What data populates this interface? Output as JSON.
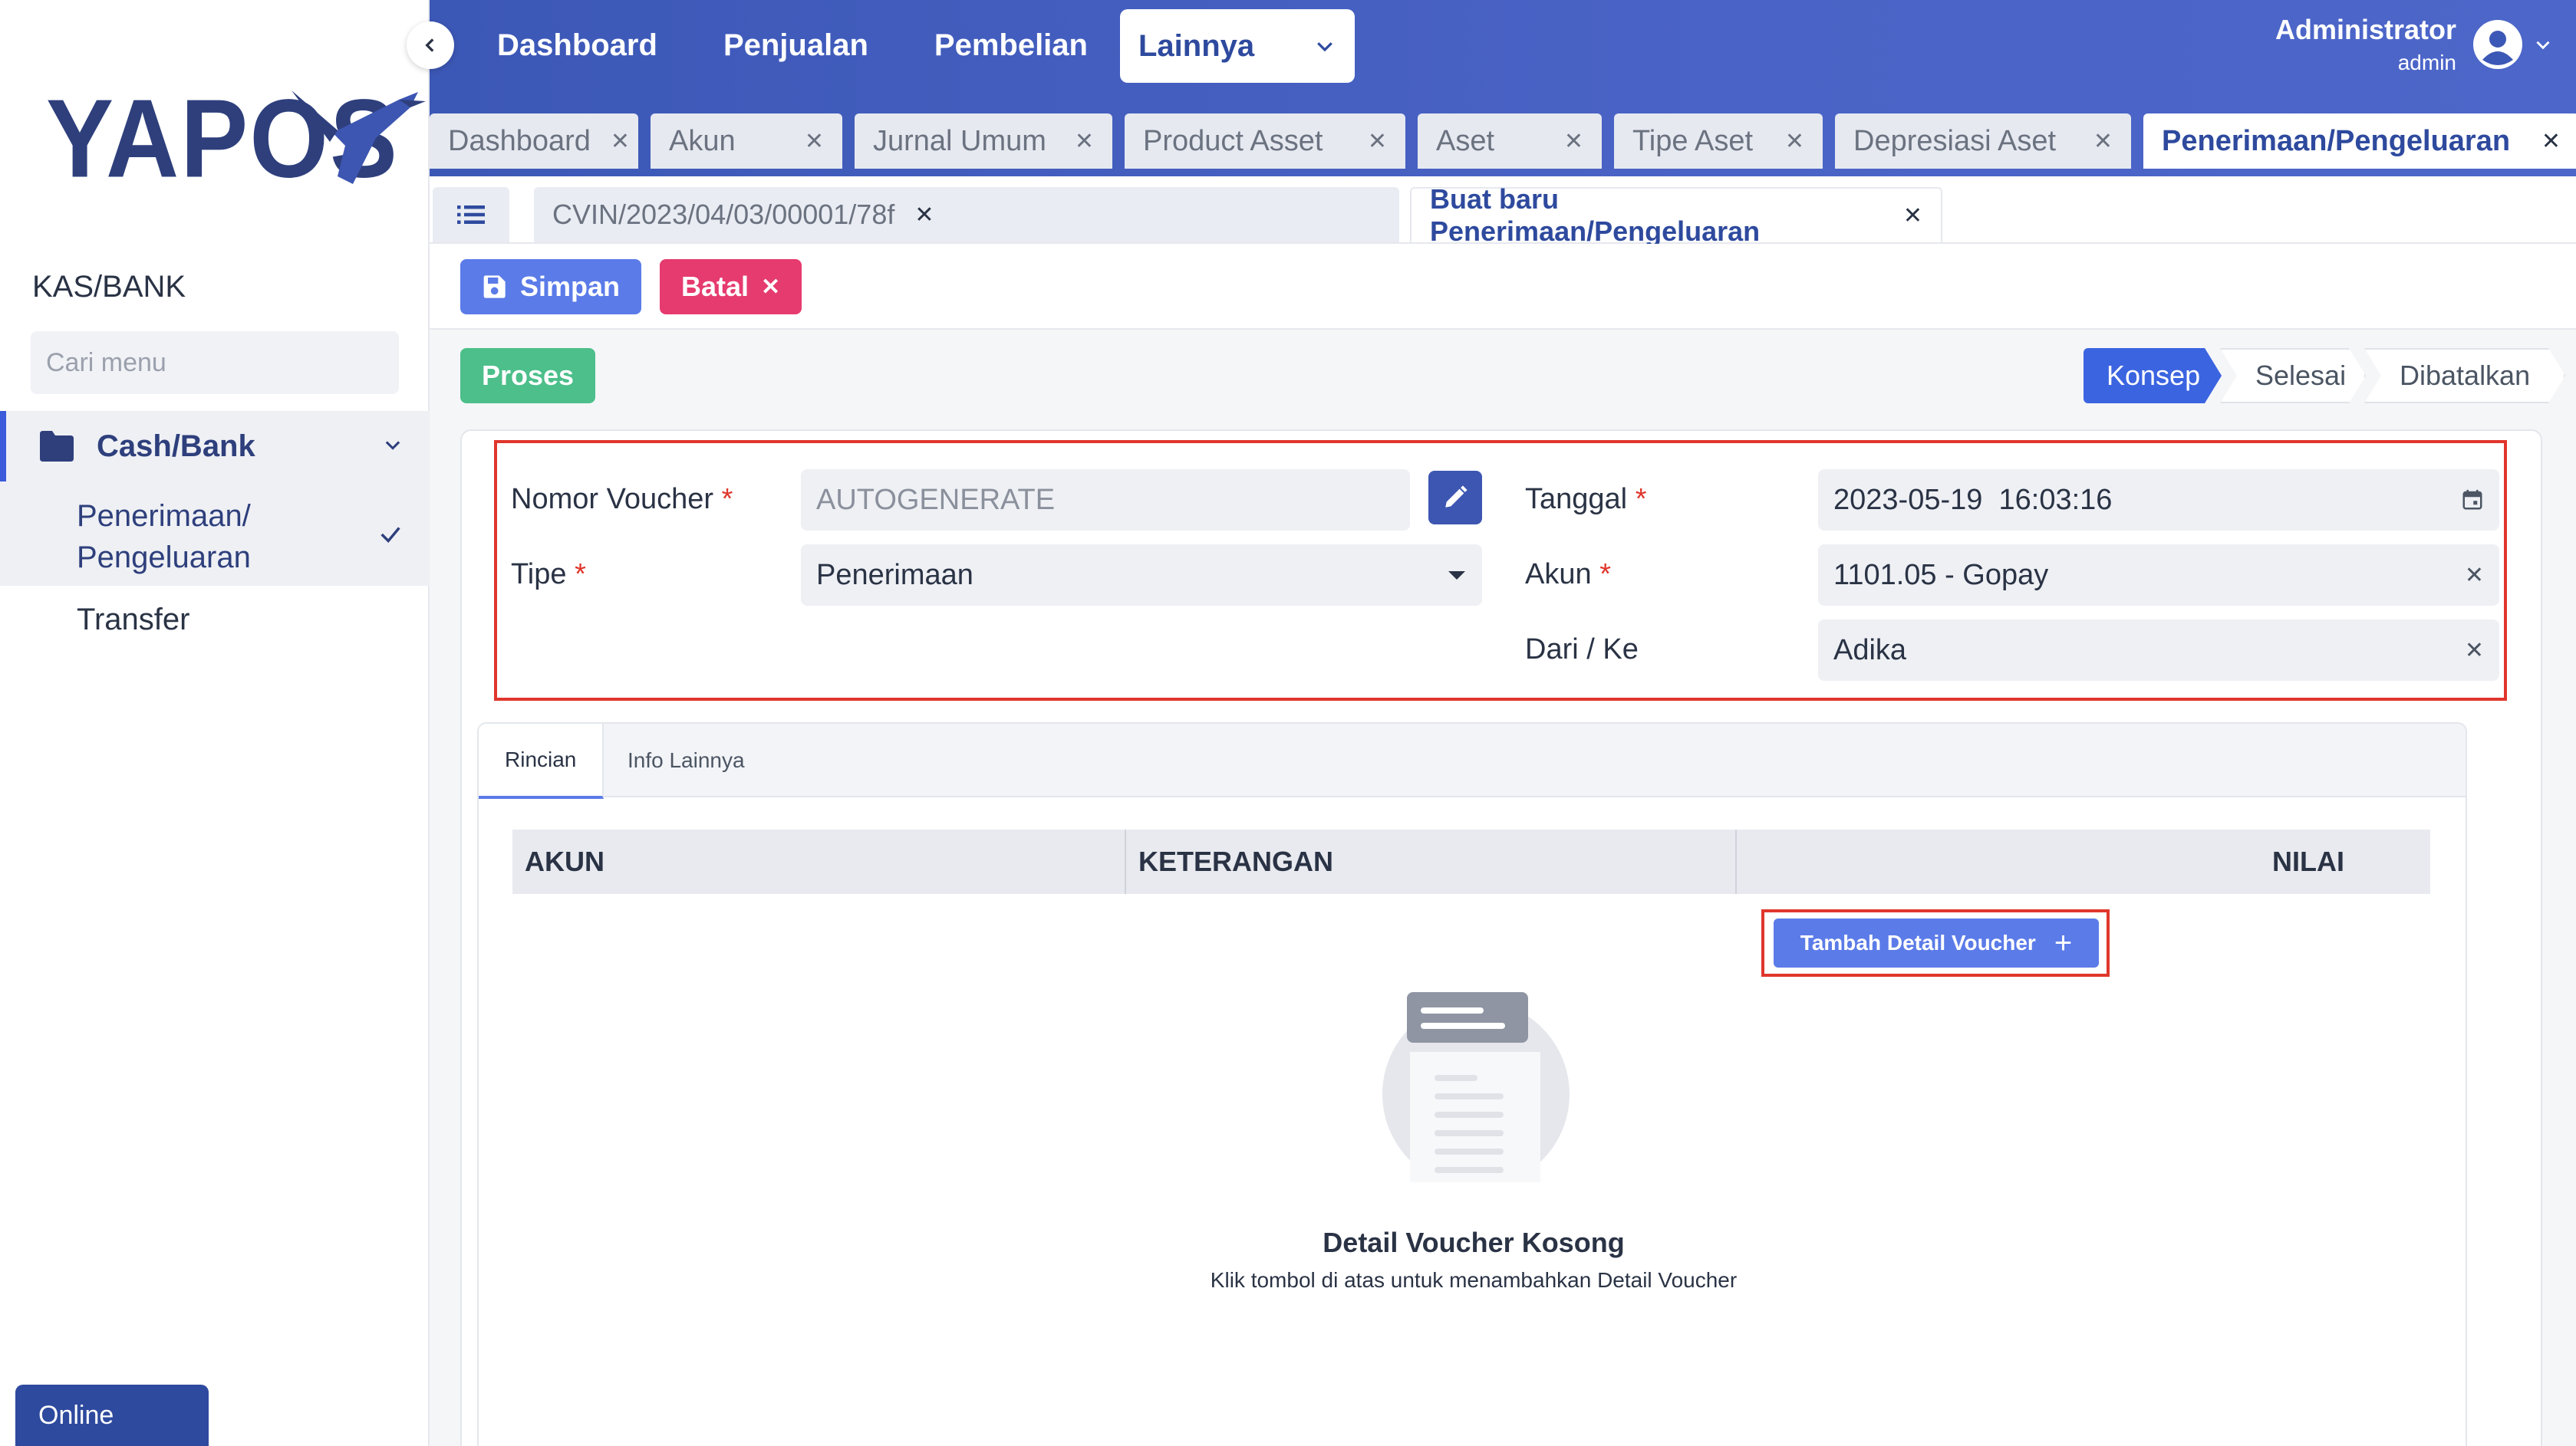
{
  "brand": {
    "name": "YAPOS"
  },
  "sidebar": {
    "section_title": "KAS/BANK",
    "search_placeholder": "Cari menu",
    "group_label": "Cash/Bank",
    "items": [
      {
        "label": "Penerimaan/ Pengeluaran",
        "active": true
      },
      {
        "label": "Transfer",
        "active": false
      }
    ],
    "status": "Online"
  },
  "topnav": {
    "items": [
      "Dashboard",
      "Penjualan",
      "Pembelian"
    ],
    "dropdown_label": "Lainnya",
    "user_name": "Administrator",
    "user_role": "admin"
  },
  "module_tabs": [
    "Dashboard",
    "Akun",
    "Jurnal Umum",
    "Product Asset",
    "Aset",
    "Tipe Aset",
    "Depresiasi Aset",
    "Penerimaan/Pengeluaran"
  ],
  "sub_tabs": [
    "CVIN/2023/04/03/00001/78f",
    "Buat baru Penerimaan/Pengeluaran"
  ],
  "actions": {
    "save": "Simpan",
    "cancel": "Batal",
    "process": "Proses"
  },
  "status_flow": [
    "Konsep",
    "Selesai",
    "Dibatalkan"
  ],
  "form": {
    "voucher_label": "Nomor Voucher",
    "voucher_value": "AUTOGENERATE",
    "type_label": "Tipe",
    "type_value": "Penerimaan",
    "date_label": "Tanggal",
    "date_value": "2023-05-19  16:03:16",
    "account_label": "Akun",
    "account_value": "1101.05 - Gopay",
    "party_label": "Dari / Ke",
    "party_value": "Adika",
    "required_mark": "*"
  },
  "detail_tabs": [
    "Rincian",
    "Info Lainnya"
  ],
  "table": {
    "columns": [
      "AKUN",
      "KETERANGAN",
      "NILAI"
    ]
  },
  "add_detail_label": "Tambah Detail Voucher",
  "empty": {
    "title": "Detail Voucher Kosong",
    "subtitle": "Klik tombol di atas untuk menambahkan Detail Voucher"
  },
  "colors": {
    "primary": "#3c58b6",
    "accent": "#5b7be8",
    "danger": "#e63b6f",
    "success": "#4cbf8a",
    "highlight": "#e0362c"
  }
}
